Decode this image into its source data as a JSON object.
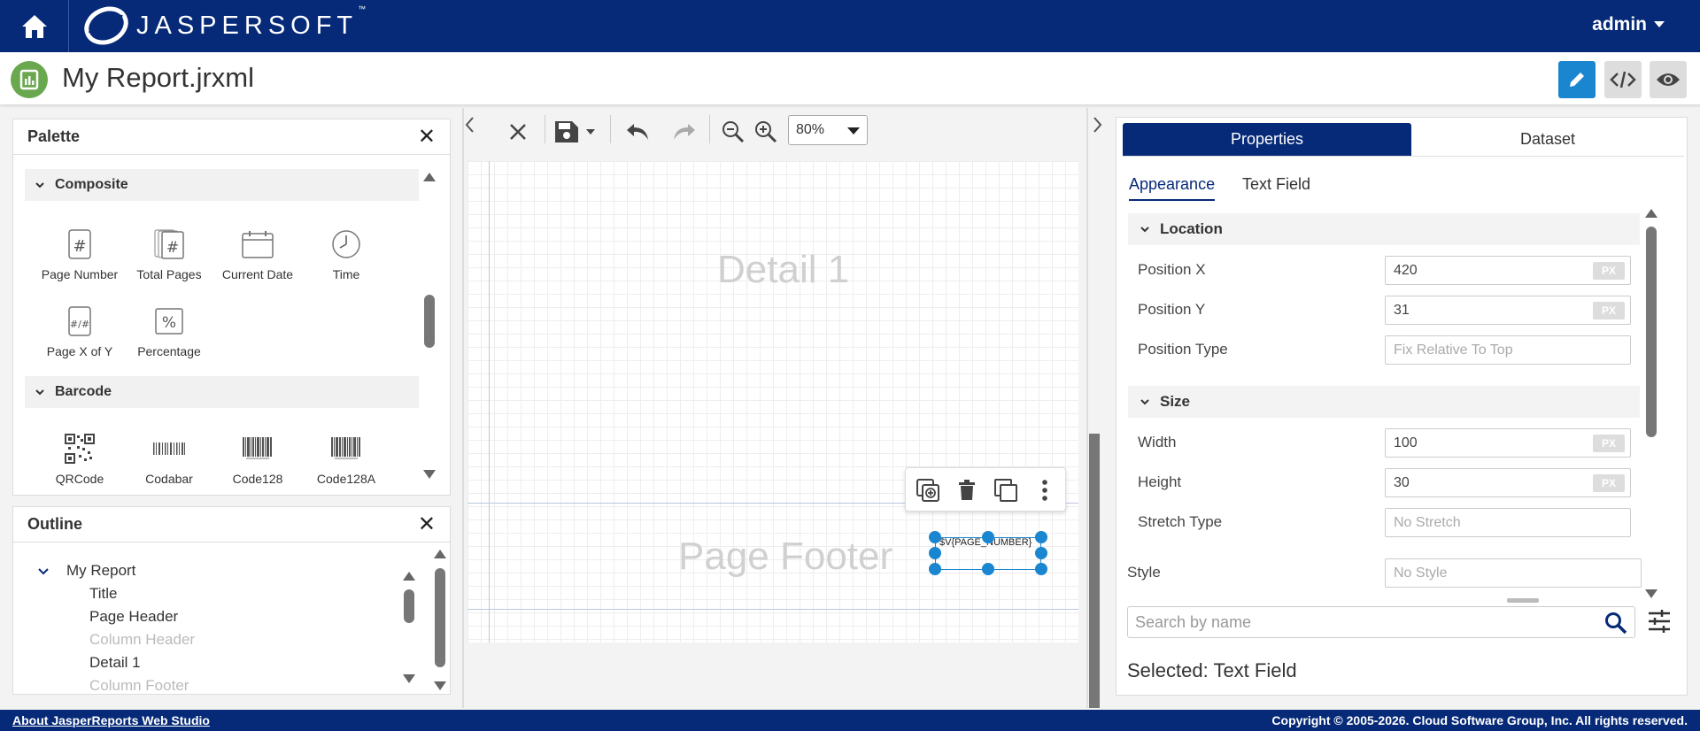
{
  "header": {
    "brand": "JASPERSOFT",
    "brand_tm": "™",
    "user": "admin"
  },
  "titlebar": {
    "title": "My Report.jrxml"
  },
  "palette": {
    "title": "Palette",
    "groups": [
      {
        "label": "Composite",
        "items": [
          "Page Number",
          "Total Pages",
          "Current Date",
          "Time",
          "Page X of Y",
          "Percentage"
        ]
      },
      {
        "label": "Barcode",
        "items": [
          "QRCode",
          "Codabar",
          "Code128",
          "Code128A"
        ]
      }
    ]
  },
  "outline": {
    "title": "Outline",
    "root": "My Report",
    "items": [
      "Title",
      "Page Header",
      "Column Header",
      "Detail 1",
      "Column Footer"
    ]
  },
  "toolbar": {
    "zoom": "80%"
  },
  "canvas": {
    "detail_band": "Detail 1",
    "footer_band": "Page Footer",
    "selected_field_text": "$V{PAGE_NUMBER}"
  },
  "properties": {
    "tabs": [
      "Properties",
      "Dataset"
    ],
    "subtabs": [
      "Appearance",
      "Text Field"
    ],
    "location_group": "Location",
    "size_group": "Size",
    "fields": {
      "position_x": {
        "label": "Position X",
        "value": "420",
        "unit": "PX"
      },
      "position_y": {
        "label": "Position Y",
        "value": "31",
        "unit": "PX"
      },
      "position_type": {
        "label": "Position Type",
        "placeholder": "Fix Relative To Top"
      },
      "width": {
        "label": "Width",
        "value": "100",
        "unit": "PX"
      },
      "height": {
        "label": "Height",
        "value": "30",
        "unit": "PX"
      },
      "stretch_type": {
        "label": "Stretch Type",
        "placeholder": "No Stretch"
      },
      "style": {
        "label": "Style",
        "placeholder": "No Style"
      }
    },
    "search_placeholder": "Search by name",
    "selected_label": "Selected: Text Field"
  },
  "footer": {
    "link": "About JasperReports Web Studio",
    "copyright": "Copyright © 2005-2026. Cloud Software Group, Inc. All rights reserved."
  },
  "colors": {
    "brand_navy": "#062a78",
    "accent_blue": "#1a86d0",
    "report_icon_green": "#6aa84f"
  }
}
